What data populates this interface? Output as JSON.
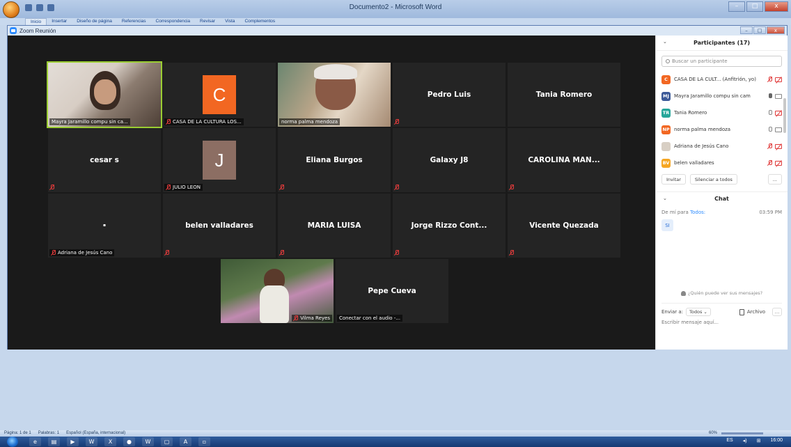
{
  "word": {
    "title": "Documento2 - Microsoft Word",
    "tabs": [
      "Inicio",
      "Insertar",
      "Diseño de página",
      "Referencias",
      "Correspondencia",
      "Revisar",
      "Vista",
      "Complementos"
    ],
    "status_page": "Página: 1 de 1",
    "status_words": "Palabras: 1",
    "status_lang": "Español (España, internacional)",
    "zoom": "60%"
  },
  "zoom": {
    "window_title": "Zoom Reunión",
    "tiles": [
      {
        "name": "Mayra Jaramillo compu sin ca...",
        "type": "video"
      },
      {
        "name": "CASA DE LA CULTURA LOS...",
        "type": "avatar",
        "letter": "C",
        "color": "#f26722"
      },
      {
        "name": "norma palma mendoza",
        "type": "video"
      },
      {
        "center": "Pedro Luis"
      },
      {
        "center": "Tania Romero"
      },
      {
        "center": "cesar s"
      },
      {
        "name": "JULIO LEON",
        "type": "avatar",
        "letter": "J",
        "color": "#8c6e63"
      },
      {
        "center": "Eliana Burgos"
      },
      {
        "center": "Galaxy J8"
      },
      {
        "center": "CAROLINA MAN..."
      },
      {
        "name": "Adriana de Jesús Cano",
        "center": "·"
      },
      {
        "center": "belen valladares"
      },
      {
        "center": "MARIA LUISA"
      },
      {
        "center": "Jorge Rizzo Cont..."
      },
      {
        "center": "Vicente Quezada"
      },
      {
        "name": "Vilma Reyes",
        "type": "video"
      },
      {
        "center": "Pepe Cueva",
        "bottom": "Conectar con el audio -..."
      }
    ]
  },
  "panel": {
    "participants_title": "Participantes (17)",
    "search_placeholder": "Buscar un participante",
    "participants": [
      {
        "initials": "C",
        "color": "#f26722",
        "name": "CASA DE LA CULT... (Anfitrión, yo)"
      },
      {
        "initials": "MJ",
        "color": "#3b5998",
        "name": "Mayra Jaramillo compu sin cam"
      },
      {
        "initials": "TR",
        "color": "#26a69a",
        "name": "Tania Romero"
      },
      {
        "initials": "NP",
        "color": "#f26722",
        "name": "norma palma mendoza"
      },
      {
        "initials": "",
        "color": "#d8cfc4",
        "name": "Adriana de Jesús Cano"
      },
      {
        "initials": "BV",
        "color": "#f5a623",
        "name": "belen valladares"
      }
    ],
    "invite": "Invitar",
    "mute_all": "Silenciar a todos",
    "more": "...",
    "chat_title": "Chat",
    "chat_from": "De mí para",
    "chat_to": "Todos:",
    "chat_time": "03:59 PM",
    "chat_message": "SI",
    "who_sees": "¿Quién puede ver sus mensajes?",
    "send_to_label": "Enviar a:",
    "send_to_value": "Todos ⌄",
    "file": "Archivo",
    "message_placeholder": "Escribir mensaje aquí..."
  },
  "taskbar": {
    "lang": "ES",
    "time": "16:00"
  }
}
